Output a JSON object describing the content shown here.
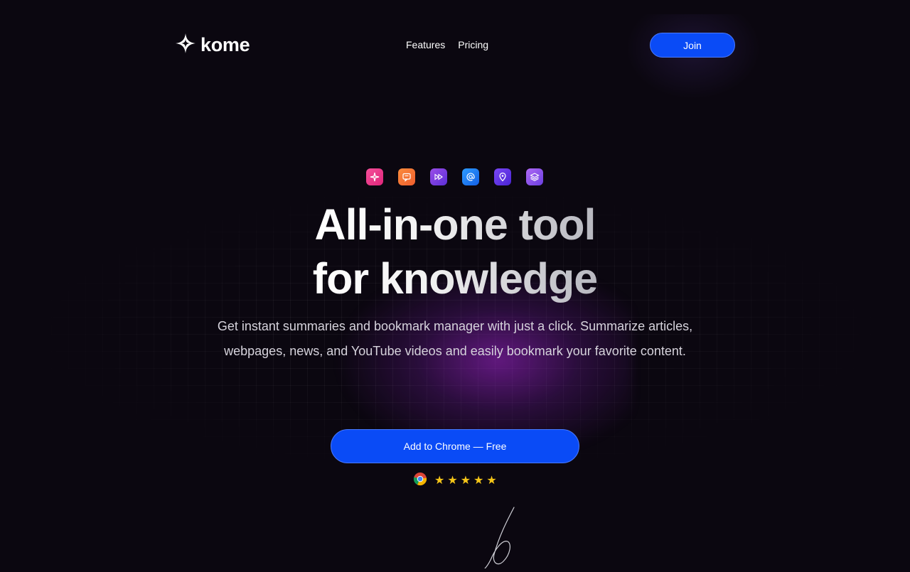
{
  "brand": {
    "name": "kome",
    "logo_icon": "four-point-star-icon"
  },
  "nav": {
    "features": "Features",
    "pricing": "Pricing"
  },
  "header": {
    "join_label": "Join"
  },
  "feature_icons": [
    {
      "name": "sparkle-icon",
      "color": "#ec3d8f"
    },
    {
      "name": "chat-icon",
      "color": "#f07a35"
    },
    {
      "name": "fast-forward-icon",
      "color": "#7c3ae0"
    },
    {
      "name": "at-sign-icon",
      "color": "#1a7ef2"
    },
    {
      "name": "location-pin-icon",
      "color": "#6b3df0"
    },
    {
      "name": "layers-icon",
      "color": "#9b4ff0"
    }
  ],
  "hero": {
    "headline_line1": "All-in-one tool",
    "headline_line2": "for knowledge",
    "subtitle_line1": "Get instant summaries and bookmark manager with just a click. Summarize articles,",
    "subtitle_line2": "webpages, news, and YouTube videos and easily bookmark your favorite content.",
    "cta_label": "Add to Chrome — Free"
  },
  "rating": {
    "browser_icon": "chrome-icon",
    "stars": 5,
    "star_color": "#f5c518"
  },
  "colors": {
    "accent": "#0a4bf6",
    "background": "#0b0710"
  }
}
